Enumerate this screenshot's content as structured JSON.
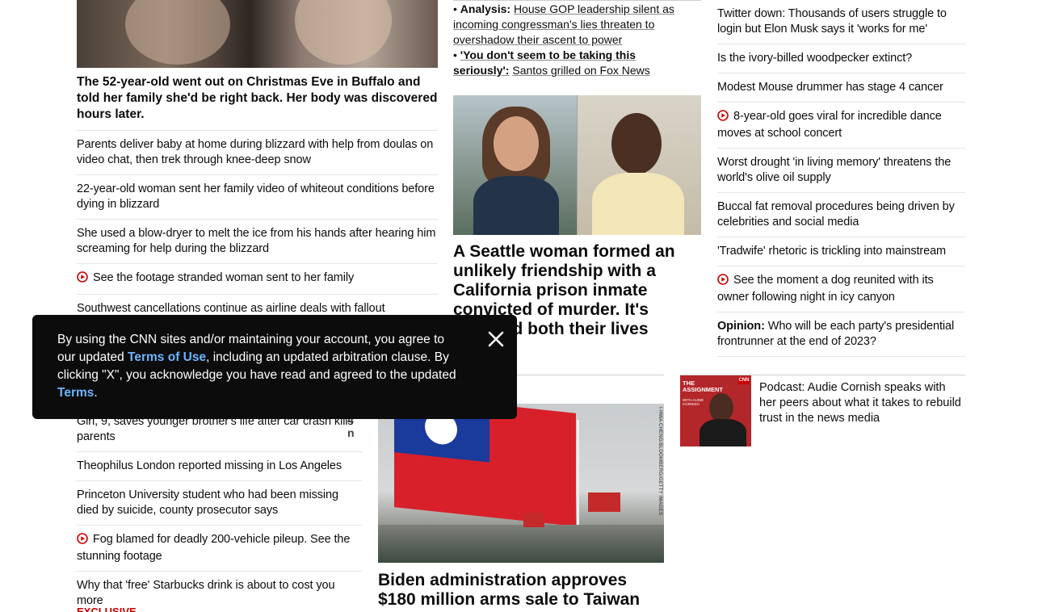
{
  "left_column": {
    "main_headline": "The 52-year-old went out on Christmas Eve in Buffalo and told her family she'd be right back. Her body was discovered hours later.",
    "items": [
      {
        "text": "Parents deliver baby at home during blizzard with help from doulas on video chat, then trek through knee-deep snow",
        "video": false
      },
      {
        "text": "22-year-old woman sent her family video of whiteout conditions before dying in blizzard",
        "video": false
      },
      {
        "text": "She used a blow-dryer to melt the ice from his hands after hearing him screaming for help during the blizzard",
        "video": false
      },
      {
        "text": "See the footage stranded woman sent to her family",
        "video": true
      },
      {
        "text": "Southwest cancellations continue as airline deals with fallout",
        "video": false
      }
    ],
    "lower_items": [
      {
        "text": "Girl, 9, saves younger brother's life after car crash kills parents",
        "video": false
      },
      {
        "text": "Theophilus London reported missing in Los Angeles",
        "video": false
      },
      {
        "text": "Princeton University student who had been missing died by suicide, county prosecutor says",
        "video": false
      },
      {
        "text": "Fog blamed for deadly 200-vehicle pileup. See the stunning footage",
        "video": true
      },
      {
        "text": "Why that 'free' Starbucks drink is about to cost you more",
        "video": false
      }
    ],
    "partial_badge": "EXCLUSIVE"
  },
  "middle_column": {
    "bullets": [
      {
        "label": "Analysis:",
        "text": "House GOP leadership silent as incoming congressman's lies threaten to overshadow their ascent to power"
      },
      {
        "label": "'You don't seem to be taking this seriously':",
        "text": "Santos grilled on Fox News"
      }
    ],
    "seattle_headline": "A Seattle woman formed an unlikely friendship with a California prison inmate convicted of murder. It's changed both their lives",
    "taiwan_headline": "Biden administration approves $180 million arms sale to Taiwan",
    "photo_credit": "I-HWA CHENG/BLOOMBERG/GETTY IMAGES"
  },
  "right_column": {
    "items": [
      {
        "label": "",
        "text": "Twitter down: Thousands of users struggle to login but Elon Musk says it 'works for me'",
        "video": false
      },
      {
        "label": "",
        "text": "Is the ivory-billed woodpecker extinct?",
        "video": false
      },
      {
        "label": "",
        "text": "Modest Mouse drummer has stage 4 cancer",
        "video": false
      },
      {
        "label": "",
        "text": "8-year-old goes viral for incredible dance moves at school concert",
        "video": true
      },
      {
        "label": "",
        "text": "Worst drought 'in living memory' threatens the world's olive oil supply",
        "video": false
      },
      {
        "label": "",
        "text": "Buccal fat removal procedures being driven by celebrities and social media",
        "video": false
      },
      {
        "label": "",
        "text": "'Tradwife' rhetoric is trickling into mainstream",
        "video": false
      },
      {
        "label": "",
        "text": "See the moment a dog reunited with its owner following night in icy canyon",
        "video": true
      },
      {
        "label": "Opinion:",
        "text": "Who will be each party's presidential frontrunner at the end of 2023?",
        "video": false
      }
    ],
    "podcast": {
      "text": "Podcast: Audie Cornish speaks with her peers about what it takes to rebuild trust in the news media",
      "thumb_brand": "CNN",
      "thumb_title": "THE ASSIGNMENT",
      "thumb_sub": "WITH AUDIE CORNISH"
    }
  },
  "consent": {
    "text_1": "By using the CNN sites and/or maintaining your account, you agree to our updated ",
    "link_1": "Terms of Use",
    "text_2": ", including an updated arbitration clause. By clicking \"X\", you acknowledge you have read and agreed to the updated ",
    "link_2": "Terms",
    "text_3": "."
  },
  "colors": {
    "video_red": "#cc0000",
    "consent_bg": "#0c0c0c",
    "consent_link": "#6eb4ff",
    "divider": "#e6e6e6"
  }
}
